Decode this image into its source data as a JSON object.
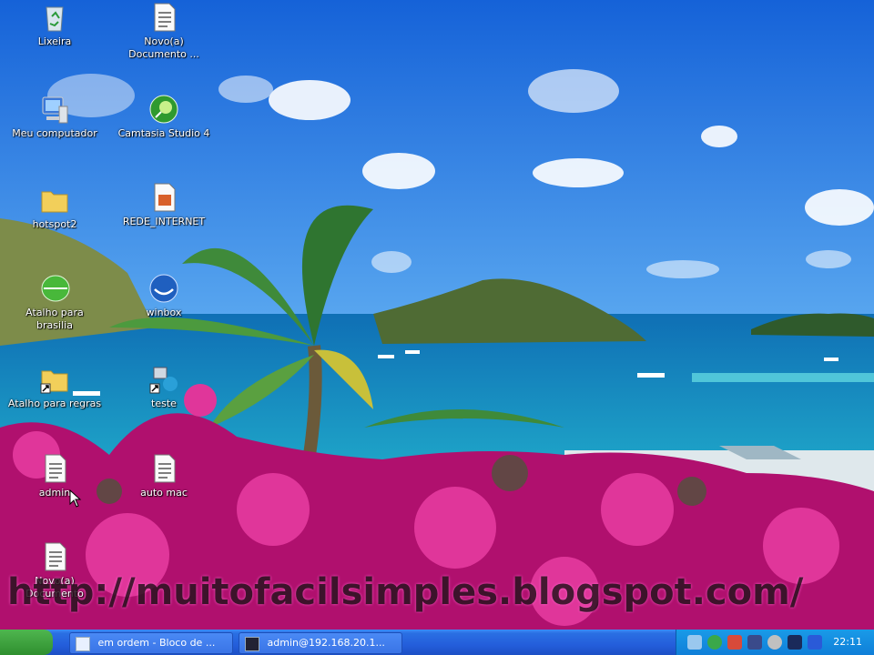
{
  "desktop": {
    "icons": [
      {
        "label": "Lixeira",
        "icon": "recycle-bin-icon"
      },
      {
        "label": "Novo(a)\nDocumento ...",
        "icon": "text-document-icon"
      },
      {
        "label": "Meu computador",
        "icon": "my-computer-icon"
      },
      {
        "label": "Camtasia Studio 4",
        "icon": "camtasia-icon"
      },
      {
        "label": "hotspot2",
        "icon": "folder-icon"
      },
      {
        "label": "REDE_INTERNET",
        "icon": "archive-icon"
      },
      {
        "label": "Atalho para\nbrasilia",
        "icon": "green-globe-icon"
      },
      {
        "label": "winbox",
        "icon": "winbox-icon"
      },
      {
        "label": "Atalho para regras",
        "icon": "folder-shortcut-icon"
      },
      {
        "label": "teste",
        "icon": "network-shortcut-icon"
      },
      {
        "label": "admin",
        "icon": "text-document-icon"
      },
      {
        "label": "auto mac",
        "icon": "text-document-icon"
      },
      {
        "label": "Novo(a)\nDocumento",
        "icon": "text-document-icon"
      }
    ]
  },
  "watermark": "http://muitofacilsimples.blogspot.com/",
  "taskbar": {
    "start_label": "",
    "tasks": [
      {
        "label": "em ordem - Bloco de ...",
        "icon": "notepad-icon"
      },
      {
        "label": "admin@192.168.20.1...",
        "icon": "terminal-icon"
      }
    ],
    "clock": "22:11"
  },
  "colors": {
    "sky": "#1e6fe0",
    "sea": "#1a8ec4",
    "flowers": "#c8147a",
    "taskbar": "#245edb",
    "tray": "#0f7fd8"
  }
}
